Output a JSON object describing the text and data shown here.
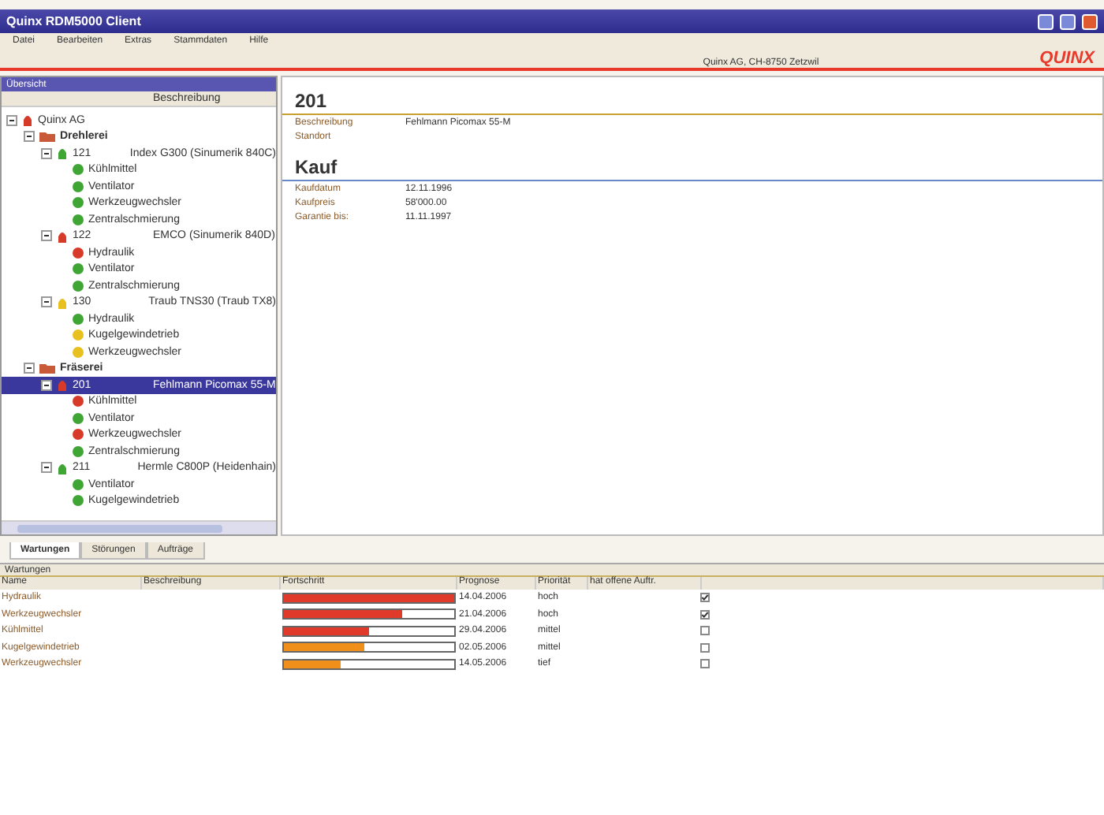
{
  "window": {
    "title": "Quinx RDM5000 Client"
  },
  "menu": [
    "Datei",
    "Bearbeiten",
    "Extras",
    "Stammdaten",
    "Hilfe"
  ],
  "banner": {
    "address": "Quinx AG, CH-8750 Zetzwil",
    "logo": "QUINX"
  },
  "overview": {
    "title": "Übersicht",
    "column": "Beschreibung",
    "tree": [
      {
        "kind": "company",
        "label": "Quinx AG",
        "color": "#d83a2a",
        "expanded": true,
        "selected": false,
        "children": [
          {
            "kind": "group",
            "label": "Drehlerei",
            "expanded": true,
            "selected": false,
            "children": [
              {
                "kind": "machine",
                "label": "121",
                "description": "Index G300 (Sinumerik 840C)",
                "color": "#3fa535",
                "expanded": true,
                "selected": false,
                "children": [
                  {
                    "kind": "part",
                    "label": "Kühlmittel",
                    "color": "#3fa535",
                    "selected": false
                  },
                  {
                    "kind": "part",
                    "label": "Ventilator",
                    "color": "#3fa535",
                    "selected": false
                  },
                  {
                    "kind": "part",
                    "label": "Werkzeugwechsler",
                    "color": "#3fa535",
                    "selected": false
                  },
                  {
                    "kind": "part",
                    "label": "Zentralschmierung",
                    "color": "#3fa535",
                    "selected": false
                  }
                ]
              },
              {
                "kind": "machine",
                "label": "122",
                "description": "EMCO (Sinumerik 840D)",
                "color": "#d83a2a",
                "expanded": true,
                "selected": false,
                "children": [
                  {
                    "kind": "part",
                    "label": "Hydraulik",
                    "color": "#d83a2a",
                    "selected": false
                  },
                  {
                    "kind": "part",
                    "label": "Ventilator",
                    "color": "#3fa535",
                    "selected": false
                  },
                  {
                    "kind": "part",
                    "label": "Zentralschmierung",
                    "color": "#3fa535",
                    "selected": false
                  }
                ]
              },
              {
                "kind": "machine",
                "label": "130",
                "description": "Traub TNS30 (Traub TX8)",
                "color": "#e8c020",
                "expanded": true,
                "selected": false,
                "children": [
                  {
                    "kind": "part",
                    "label": "Hydraulik",
                    "color": "#3fa535",
                    "selected": false
                  },
                  {
                    "kind": "part",
                    "label": "Kugelgewindetrieb",
                    "color": "#e8c020",
                    "selected": false
                  },
                  {
                    "kind": "part",
                    "label": "Werkzeugwechsler",
                    "color": "#e8c020",
                    "selected": false
                  }
                ]
              }
            ]
          },
          {
            "kind": "group",
            "label": "Fräserei",
            "expanded": true,
            "selected": false,
            "children": [
              {
                "kind": "machine",
                "label": "201",
                "description": "Fehlmann Picomax 55-M",
                "color": "#d83a2a",
                "expanded": true,
                "selected": true,
                "children": [
                  {
                    "kind": "part",
                    "label": "Kühlmittel",
                    "color": "#d83a2a",
                    "selected": false
                  },
                  {
                    "kind": "part",
                    "label": "Ventilator",
                    "color": "#3fa535",
                    "selected": false
                  },
                  {
                    "kind": "part",
                    "label": "Werkzeugwechsler",
                    "color": "#d83a2a",
                    "selected": false
                  },
                  {
                    "kind": "part",
                    "label": "Zentralschmierung",
                    "color": "#3fa535",
                    "selected": false
                  }
                ]
              },
              {
                "kind": "machine",
                "label": "211",
                "description": "Hermle C800P (Heidenhain)",
                "color": "#3fa535",
                "expanded": true,
                "selected": false,
                "children": [
                  {
                    "kind": "part",
                    "label": "Ventilator",
                    "color": "#3fa535",
                    "selected": false
                  },
                  {
                    "kind": "part",
                    "label": "Kugelgewindetrieb",
                    "color": "#3fa535",
                    "selected": false
                  }
                ]
              }
            ]
          }
        ]
      }
    ]
  },
  "detail": {
    "title": "201",
    "fields": [
      {
        "label": "Beschreibung",
        "value": "Fehlmann Picomax 55-M"
      },
      {
        "label": "Standort"
      }
    ],
    "section": "Kauf",
    "purchase": [
      {
        "label": "Kaufdatum",
        "value": "12.11.1996"
      },
      {
        "label": "Kaufpreis",
        "value": "58'000.00"
      },
      {
        "label": "Garantie bis:",
        "value": "11.11.1997"
      }
    ]
  },
  "tabs": [
    {
      "label": "Wartungen",
      "selected": true
    },
    {
      "label": "Störungen",
      "selected": false
    },
    {
      "label": "Aufträge",
      "selected": false
    }
  ],
  "maintenance": {
    "title": "Wartungen",
    "columns": [
      "Name",
      "Beschreibung",
      "Fortschritt",
      "Prognose",
      "Priorität",
      "hat offene Auftr."
    ],
    "rows": [
      {
        "name": "Hydraulik",
        "level": 1.0,
        "color": "#e03a2a",
        "forecast": "14.04.2006",
        "priority": "hoch",
        "checked": true
      },
      {
        "name": "Werkzeugwechsler",
        "level": 0.69,
        "color": "#e03a2a",
        "forecast": "21.04.2006",
        "priority": "hoch",
        "checked": true
      },
      {
        "name": "Kühlmittel",
        "level": 0.5,
        "color": "#e03a2a",
        "forecast": "29.04.2006",
        "priority": "mittel",
        "checked": false
      },
      {
        "name": "Kugelgewindetrieb",
        "level": 0.47,
        "color": "#f0901a",
        "forecast": "02.05.2006",
        "priority": "mittel",
        "checked": false
      },
      {
        "name": "Werkzeugwechsler",
        "level": 0.33,
        "color": "#f0901a",
        "forecast": "14.05.2006",
        "priority": "tief",
        "checked": false
      }
    ]
  }
}
